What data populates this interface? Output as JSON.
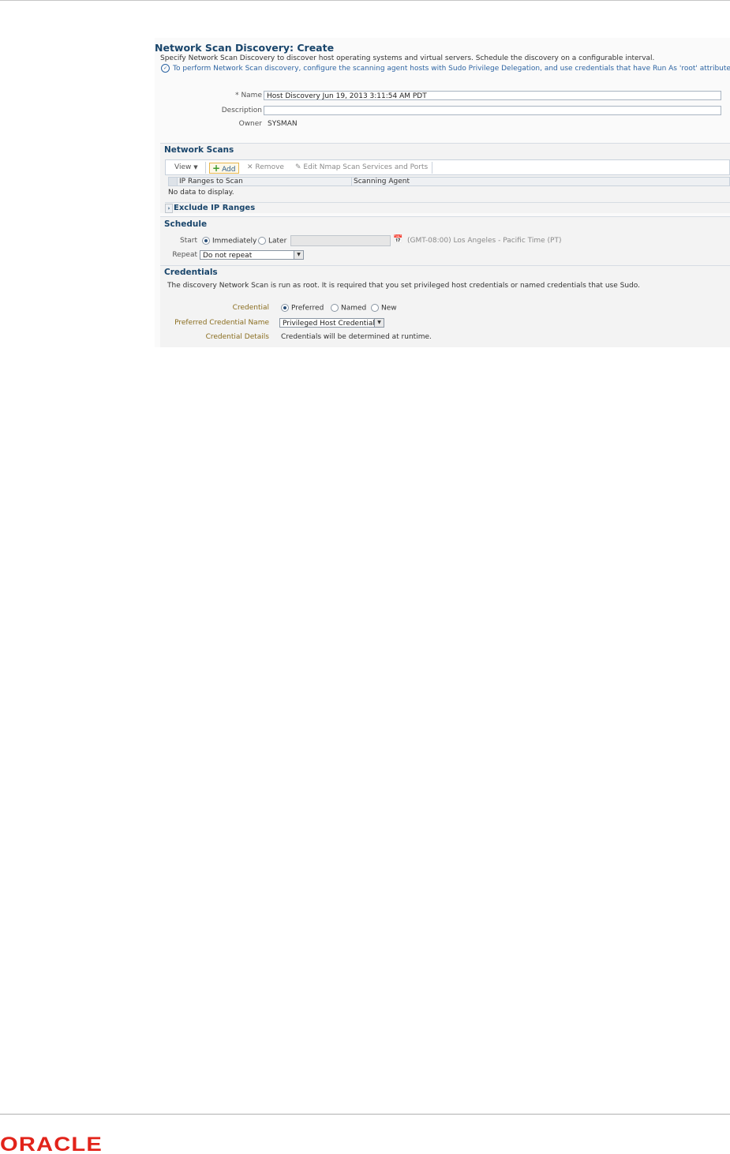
{
  "page": {
    "title": "Network Scan Discovery: Create",
    "description": "Specify Network Scan Discovery to discover host operating systems and virtual servers. Schedule the discovery on a configurable interval.",
    "hint": "To perform Network Scan discovery, configure the scanning agent hosts with Sudo Privilege Delegation, and use credentials that have Run As 'root' attribute set."
  },
  "form": {
    "name_req": "*",
    "name_label": "Name",
    "name_value": "Host Discovery Jun 19, 2013 3:11:54 AM PDT",
    "description_label": "Description",
    "description_value": "",
    "owner_label": "Owner",
    "owner_value": "SYSMAN"
  },
  "network_scans": {
    "title": "Network Scans",
    "view_label": "View",
    "add_label": "Add",
    "remove_label": "Remove",
    "edit_label": "Edit Nmap Scan Services and Ports",
    "columns": [
      "IP Ranges to Scan",
      "Scanning Agent"
    ],
    "empty_text": "No data to display."
  },
  "exclude": {
    "title": "Exclude IP Ranges"
  },
  "schedule": {
    "title": "Schedule",
    "start_label": "Start",
    "immediately_label": "Immediately",
    "later_label": "Later",
    "later_value": "",
    "timezone": "(GMT-08:00) Los Angeles - Pacific Time (PT)",
    "repeat_label": "Repeat",
    "repeat_value": "Do not repeat"
  },
  "credentials": {
    "title": "Credentials",
    "note": "The discovery Network Scan is run as root. It is required that you set privileged host credentials or named credentials that use Sudo.",
    "credential_label": "Credential",
    "preferred_label": "Preferred",
    "named_label": "Named",
    "new_label": "New",
    "pref_name_label": "Preferred Credential Name",
    "pref_name_value": "Privileged Host Credentials",
    "details_label": "Credential Details",
    "details_value": "Credentials will be determined at runtime."
  },
  "footer": {
    "logo_text": "ORACLE"
  },
  "colors": {
    "title": "#19456b",
    "link": "#2e65a3",
    "logo": "#e2231a"
  }
}
